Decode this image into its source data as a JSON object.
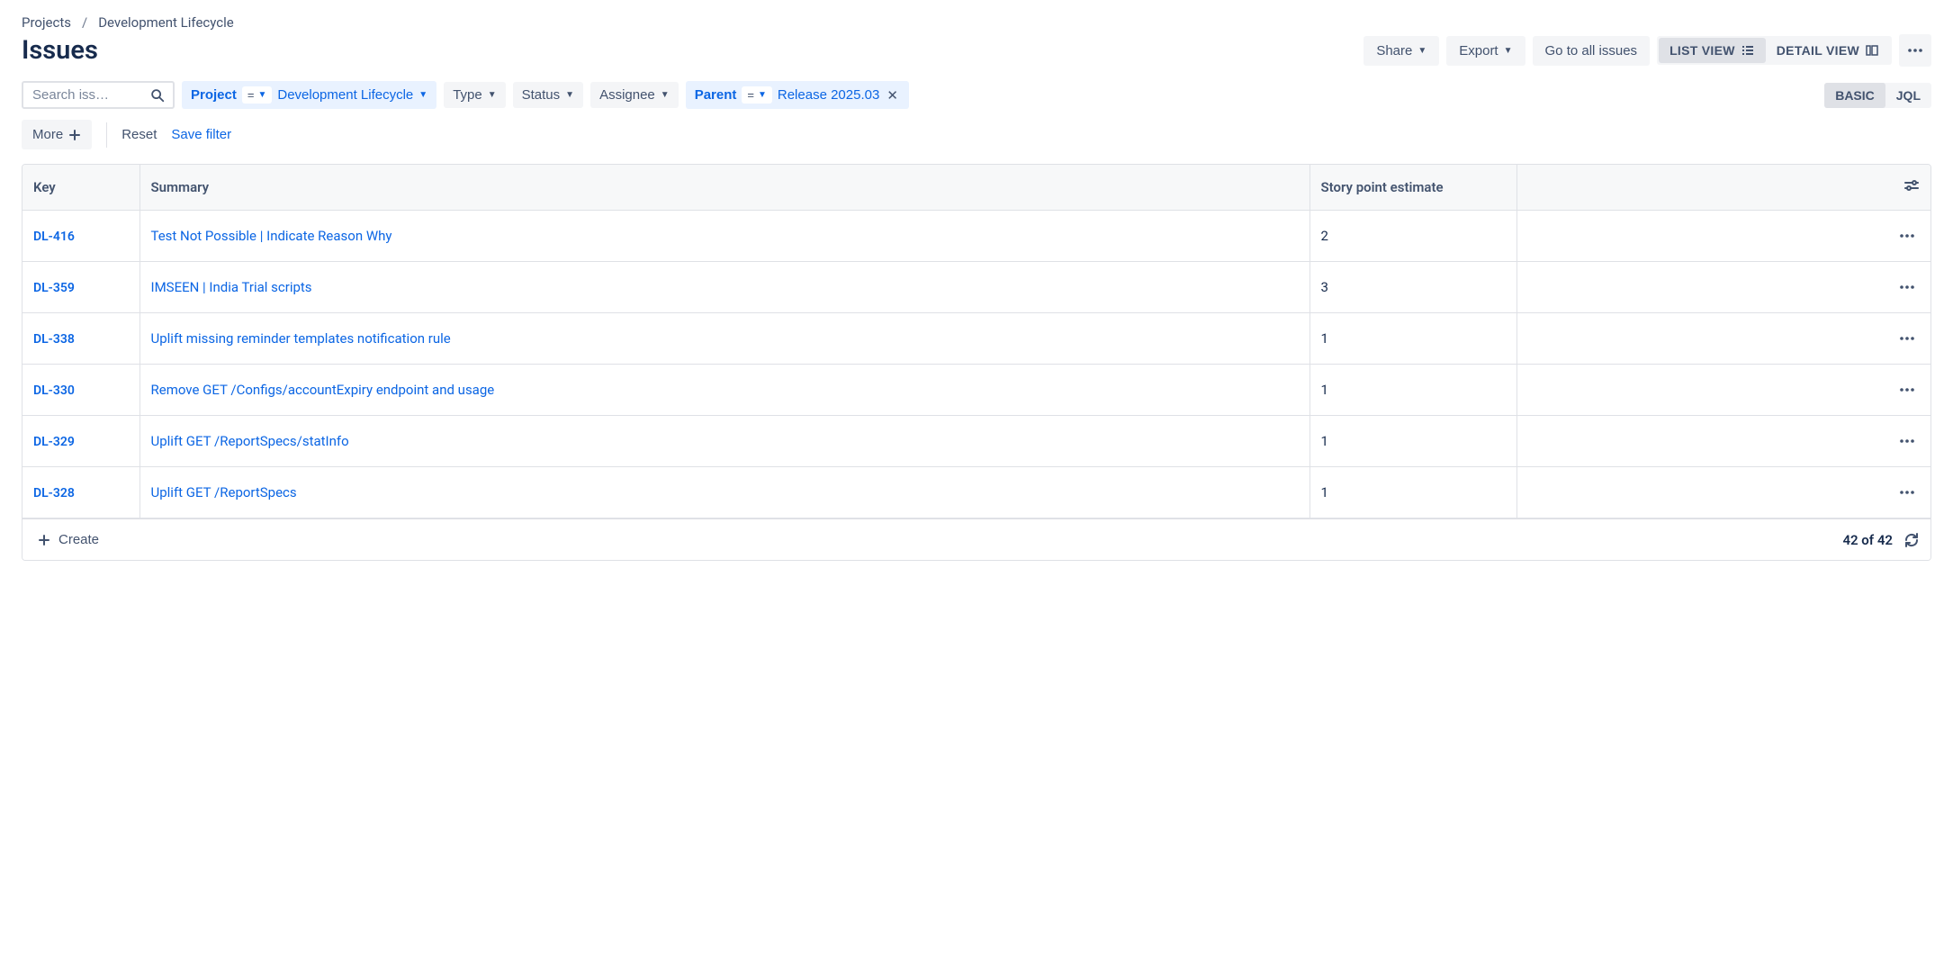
{
  "breadcrumb": {
    "projects": "Projects",
    "project": "Development Lifecycle"
  },
  "page_title": "Issues",
  "header_buttons": {
    "share": "Share",
    "export": "Export",
    "go_all": "Go to all issues"
  },
  "view_toggle": {
    "list": "LIST VIEW",
    "detail": "DETAIL VIEW"
  },
  "search_placeholder": "Search iss…",
  "filters": {
    "project": {
      "label": "Project",
      "op": "=",
      "value": "Development Lifecycle"
    },
    "type": "Type",
    "status": "Status",
    "assignee": "Assignee",
    "parent": {
      "label": "Parent",
      "op": "=",
      "value": "Release 2025.03"
    }
  },
  "mode": {
    "basic": "BASIC",
    "jql": "JQL"
  },
  "more": "More",
  "reset": "Reset",
  "save_filter": "Save filter",
  "columns": {
    "key": "Key",
    "summary": "Summary",
    "sp": "Story point estimate"
  },
  "rows": [
    {
      "key": "DL-416",
      "summary": "Test Not Possible | Indicate Reason Why",
      "sp": "2"
    },
    {
      "key": "DL-359",
      "summary": "IMSEEN | India Trial scripts",
      "sp": "3"
    },
    {
      "key": "DL-338",
      "summary": "Uplift missing reminder templates notification rule",
      "sp": "1"
    },
    {
      "key": "DL-330",
      "summary": "Remove GET /Configs/accountExpiry endpoint and usage",
      "sp": "1"
    },
    {
      "key": "DL-329",
      "summary": "Uplift GET /ReportSpecs/statInfo",
      "sp": "1"
    },
    {
      "key": "DL-328",
      "summary": "Uplift GET /ReportSpecs",
      "sp": "1"
    }
  ],
  "create": "Create",
  "footer_count": "42 of 42"
}
